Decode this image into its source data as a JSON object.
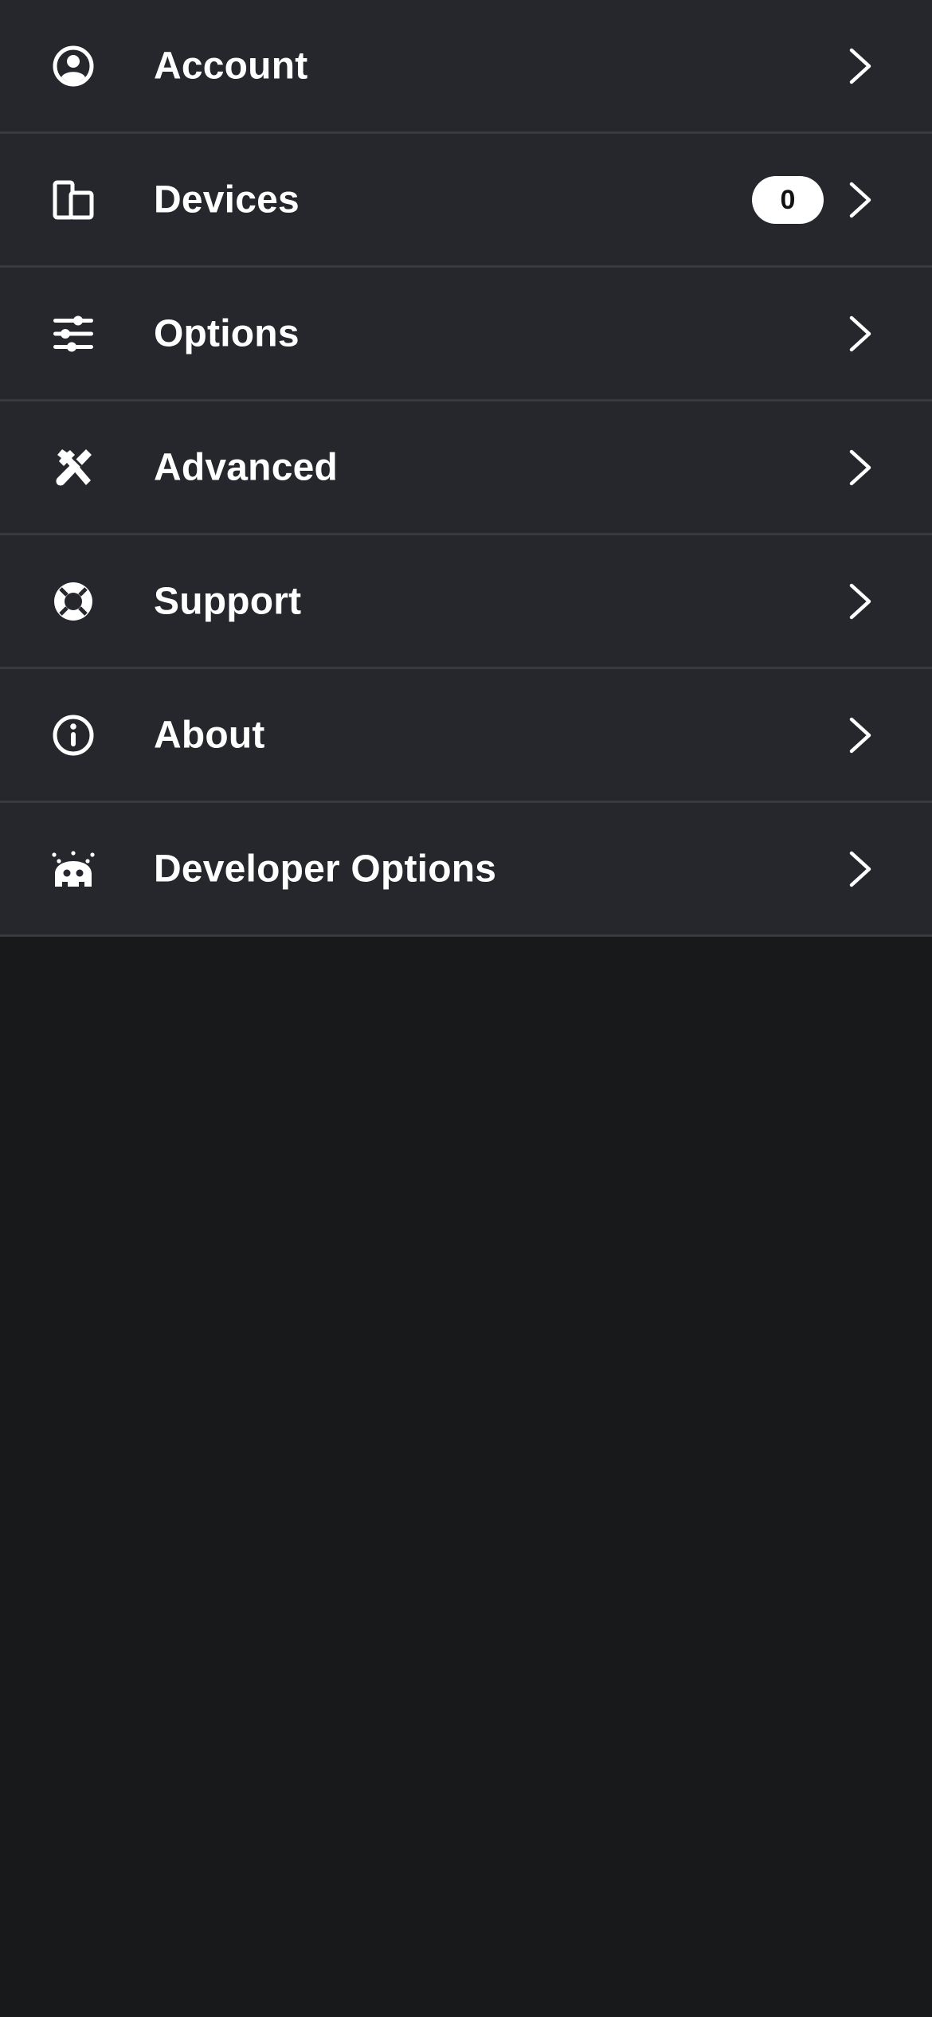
{
  "menu": {
    "items": [
      {
        "label": "Account",
        "icon": "account-circle-icon"
      },
      {
        "label": "Devices",
        "icon": "devices-icon",
        "badge": "0"
      },
      {
        "label": "Options",
        "icon": "sliders-icon"
      },
      {
        "label": "Advanced",
        "icon": "tools-icon"
      },
      {
        "label": "Support",
        "icon": "lifebuoy-icon"
      },
      {
        "label": "About",
        "icon": "info-circle-icon"
      },
      {
        "label": "Developer Options",
        "icon": "developer-bug-icon"
      }
    ]
  },
  "colors": {
    "page_background": "#18191b",
    "row_background": "#26272d",
    "divider": "#393a40",
    "text": "#ffffff",
    "badge_background": "#ffffff",
    "badge_text": "#111111"
  }
}
